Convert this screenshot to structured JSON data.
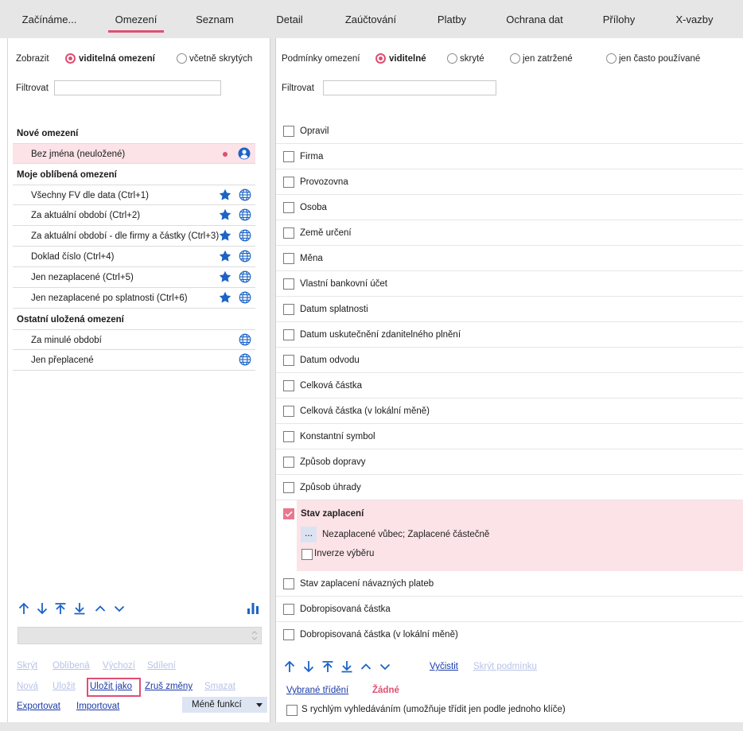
{
  "tabs": [
    {
      "label": "Začínáme..."
    },
    {
      "label": "Omezení"
    },
    {
      "label": "Seznam"
    },
    {
      "label": "Detail"
    },
    {
      "label": "Zaúčtování"
    },
    {
      "label": "Platby"
    },
    {
      "label": "Ochrana dat"
    },
    {
      "label": "Přílohy"
    },
    {
      "label": "X-vazby"
    }
  ],
  "left": {
    "show_label": "Zobrazit",
    "radio_visible": "viditelná omezení",
    "radio_hidden": "včetně skrytých",
    "filter_label": "Filtrovat",
    "filter_value": "",
    "section_new": "Nové omezení",
    "new_item": "Bez jména (neuložené)",
    "section_favorites": "Moje oblíbená omezení",
    "favorites": [
      {
        "label": "Všechny FV dle data (Ctrl+1)"
      },
      {
        "label": "Za aktuální období (Ctrl+2)"
      },
      {
        "label": "Za aktuální období - dle firmy a částky (Ctrl+3)"
      },
      {
        "label": "Doklad číslo (Ctrl+4)"
      },
      {
        "label": "Jen nezaplacené (Ctrl+5)"
      },
      {
        "label": "Jen nezaplacené po splatnosti (Ctrl+6)"
      }
    ],
    "section_other": "Ostatní uložená omezení",
    "others": [
      {
        "label": "Za minulé období"
      },
      {
        "label": "Jen přeplacené"
      }
    ],
    "actions_row1": {
      "hide": "Skrýt",
      "favorite": "Oblíbená",
      "default": "Výchozí",
      "share": "Sdílení"
    },
    "actions_row2": {
      "new": "Nová",
      "save": "Uložit",
      "save_as": "Uložit jako",
      "undo": "Zruš změny",
      "delete": "Smazat"
    },
    "actions_row3": {
      "export": "Exportovat",
      "import": "Importovat",
      "less": "Méně funkcí"
    }
  },
  "right": {
    "conditions_label": "Podmínky omezení",
    "radio_visible": "viditelné",
    "radio_hidden": "skryté",
    "radio_marked": "jen zatržené",
    "radio_frequent": "jen často používané",
    "filter_label": "Filtrovat",
    "filter_value": "",
    "conditions": [
      {
        "label": "Opravil"
      },
      {
        "label": "Firma"
      },
      {
        "label": "Provozovna"
      },
      {
        "label": "Osoba"
      },
      {
        "label": "Země určení"
      },
      {
        "label": "Měna"
      },
      {
        "label": "Vlastní bankovní účet"
      },
      {
        "label": "Datum splatnosti"
      },
      {
        "label": "Datum uskutečnění zdanitelného plnění"
      },
      {
        "label": "Datum odvodu"
      },
      {
        "label": "Celková částka"
      },
      {
        "label": "Celková částka (v lokální měně)"
      },
      {
        "label": "Konstantní symbol"
      },
      {
        "label": "Způsob dopravy"
      },
      {
        "label": "Způsob úhrady"
      }
    ],
    "expanded": {
      "label": "Stav zaplacení",
      "dots": "...",
      "value": "Nezaplacené vůbec; Zaplacené částečně",
      "inverse": "Inverze výběru"
    },
    "conditions_after": [
      {
        "label": "Stav zaplacení návazných plateb"
      },
      {
        "label": "Dobropisovaná částka"
      },
      {
        "label": "Dobropisovaná částka (v lokální měně)"
      }
    ],
    "clear": "Vyčistit",
    "hide_condition": "Skrýt podmínku",
    "sort_label": "Vybrané třídění",
    "sort_value": "Žádné",
    "quick_search": "S rychlým vyhledáváním (umožňuje třídit jen podle jednoho klíče)"
  },
  "colors": {
    "accent": "#e04e72",
    "icon_blue": "#1b63c6",
    "link": "#1a3aa8",
    "selected_bg": "#fbe3e8"
  }
}
